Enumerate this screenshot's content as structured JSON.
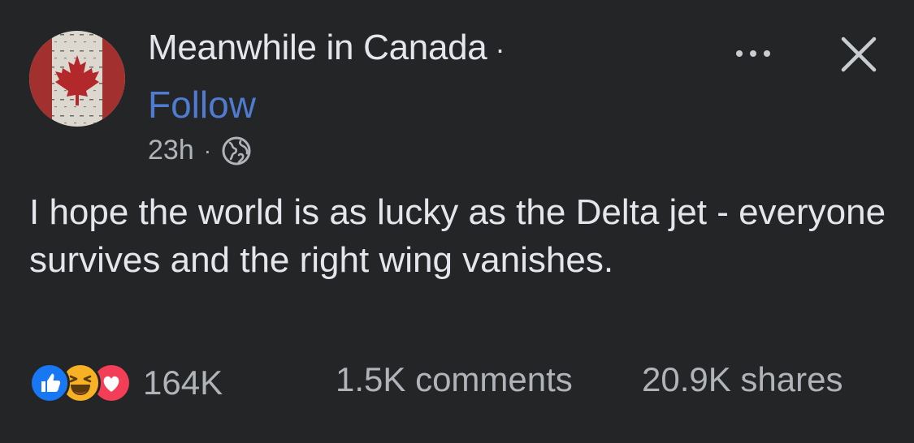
{
  "header": {
    "page_name": "Meanwhile in Canada",
    "name_separator": "·",
    "follow_label": "Follow",
    "timestamp": "23h",
    "meta_separator": "·",
    "audience_icon": "globe-icon"
  },
  "actions": {
    "more_icon": "more-horizontal-icon",
    "close_icon": "close-icon"
  },
  "post": {
    "text": "I hope the world is as lucky as the Delta jet - everyone survives and the right wing vanishes."
  },
  "engagement": {
    "reaction_icons": [
      "like-icon",
      "haha-icon",
      "love-icon"
    ],
    "reaction_count": "164K",
    "comments": "1.5K comments",
    "shares": "20.9K shares"
  },
  "colors": {
    "background": "#242526",
    "text": "#e4e6eb",
    "secondary_text": "#b0b3b8",
    "follow_link": "#4f7bd1",
    "like": "#1877f2",
    "love": "#f33e58",
    "haha": "#f7b125"
  }
}
